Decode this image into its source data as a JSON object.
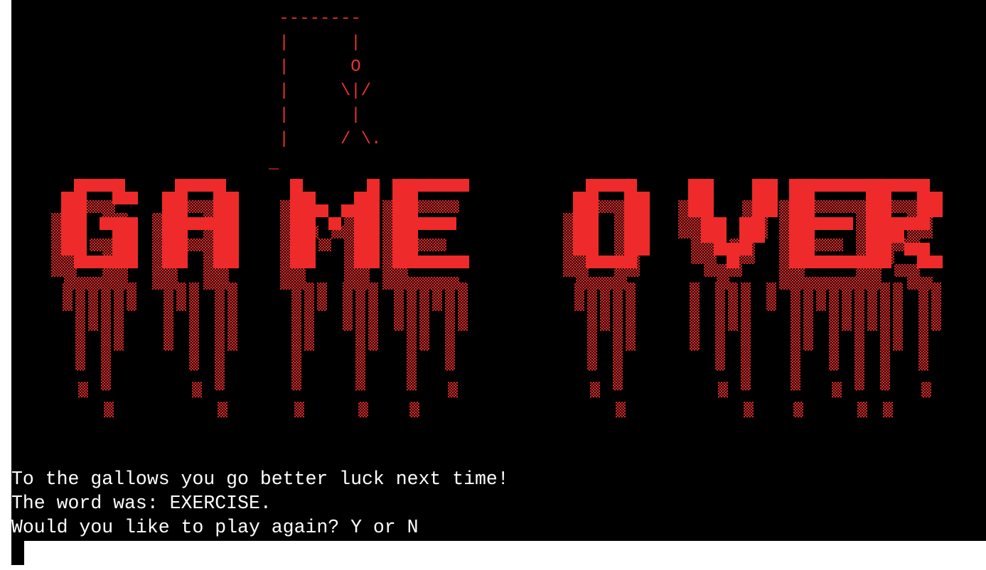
{
  "terminal": {
    "background": "#000000",
    "accent": "#e8322f",
    "text_color": "#ffffff"
  },
  "gallows_art": " --------\n |      |\n |      O\n |     \\|/\n |      |\n |     / \\.\n_",
  "banner": {
    "text": "GAME OVER",
    "style": "dripping blood pixel letters",
    "color": "#ee2a2a"
  },
  "messages": {
    "line1": "To the gallows you go better luck next time!",
    "line2": "The word was: EXERCISE.",
    "line3": "Would you like to play again? Y or N"
  }
}
